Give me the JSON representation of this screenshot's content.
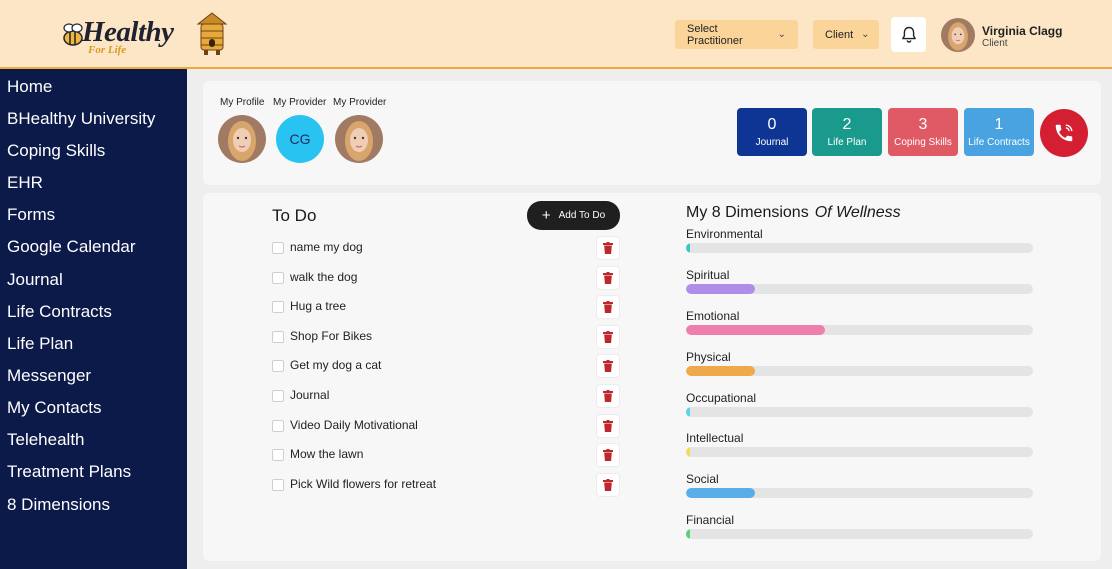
{
  "header": {
    "logo": {
      "text": "Healthy",
      "sub": "For Life"
    },
    "select_practitioner": "Select Practitioner",
    "client_dropdown": "Client",
    "user": {
      "name": "Virginia Clagg",
      "role": "Client"
    }
  },
  "sidebar": {
    "items": [
      {
        "label": "Home"
      },
      {
        "label": "BHealthy University"
      },
      {
        "label": "Coping Skills"
      },
      {
        "label": "EHR"
      },
      {
        "label": "Forms"
      },
      {
        "label": "Google Calendar"
      },
      {
        "label": "Journal"
      },
      {
        "label": "Life Contracts"
      },
      {
        "label": "Life Plan"
      },
      {
        "label": "Messenger"
      },
      {
        "label": "My Contacts"
      },
      {
        "label": "Telehealth"
      },
      {
        "label": "Treatment Plans"
      },
      {
        "label": "8 Dimensions"
      }
    ]
  },
  "profile": {
    "my_profile": "My Profile",
    "provider1_label": "My Provider",
    "provider1_initials": "CG",
    "provider2_label": "My Provider"
  },
  "stats": [
    {
      "value": "0",
      "label": "Journal",
      "color": "#0f3594"
    },
    {
      "value": "2",
      "label": "Life Plan",
      "color": "#1a9a8d"
    },
    {
      "value": "3",
      "label": "Coping Skills",
      "color": "#e05a66"
    },
    {
      "value": "1",
      "label": "Life Contracts",
      "color": "#48a3e0"
    }
  ],
  "todo": {
    "title": "To Do",
    "add_label": "Add To Do",
    "items": [
      {
        "text": "name my dog"
      },
      {
        "text": "walk the dog"
      },
      {
        "text": "Hug a tree"
      },
      {
        "text": "Shop For Bikes"
      },
      {
        "text": "Get my dog a cat"
      },
      {
        "text": "Journal"
      },
      {
        "text": "Video Daily Motivational"
      },
      {
        "text": "Mow the lawn"
      },
      {
        "text": "Pick Wild flowers for retreat"
      }
    ]
  },
  "dimensions": {
    "title": "My 8 Dimensions",
    "title_italic": "Of Wellness",
    "items": [
      {
        "label": "Environmental",
        "level": 0.012,
        "color": "#3ec7c0"
      },
      {
        "label": "Spiritual",
        "level": 0.2,
        "color": "#b08ee8"
      },
      {
        "label": "Emotional",
        "level": 0.4,
        "color": "#ee7fad"
      },
      {
        "label": "Physical",
        "level": 0.2,
        "color": "#eea94a"
      },
      {
        "label": "Occupational",
        "level": 0.012,
        "color": "#56d6ea"
      },
      {
        "label": "Intellectual",
        "level": 0.012,
        "color": "#f2dd5a"
      },
      {
        "label": "Social",
        "level": 0.2,
        "color": "#5aaee8"
      },
      {
        "label": "Financial",
        "level": 0.012,
        "color": "#5ccf7a"
      }
    ]
  }
}
